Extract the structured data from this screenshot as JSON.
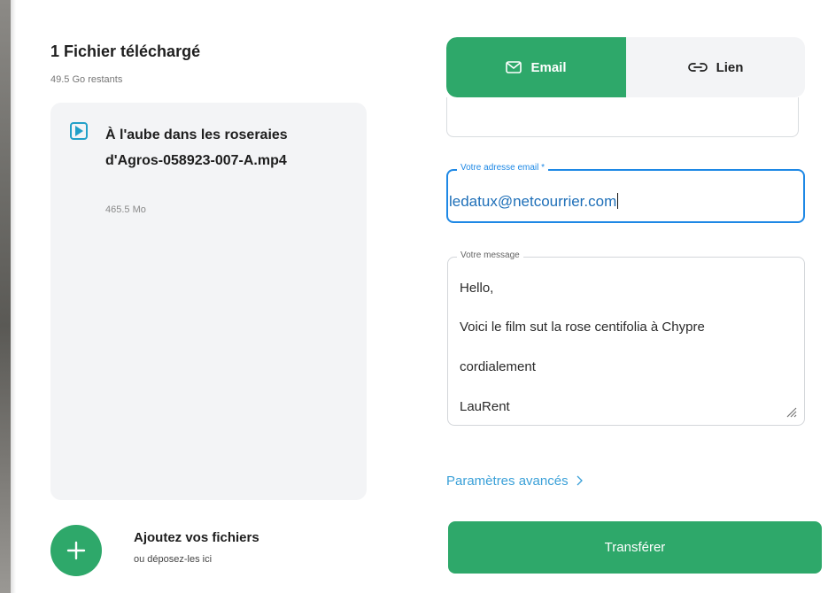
{
  "upload_panel": {
    "title": "1 Fichier téléchargé",
    "remaining": "49.5 Go restants",
    "file": {
      "name": "À l'aube dans les roseraies d'Agros-058923-007-A.mp4",
      "size": "465.5 Mo",
      "icon": "video-file-icon"
    },
    "add": {
      "title": "Ajoutez vos fichiers",
      "subtitle": "ou déposez-les ici",
      "icon": "plus-icon"
    }
  },
  "tabs": [
    {
      "label": "Email",
      "icon": "envelope-icon",
      "active": true
    },
    {
      "label": "Lien",
      "icon": "link-icon",
      "active": false
    }
  ],
  "form": {
    "email_label": "Votre adresse email *",
    "email_value": "ledatux@netcourrier.com",
    "message_label": "Votre message",
    "message_lines": [
      "Hello,",
      "Voici le film sut la rose centifolia à Chypre",
      "cordialement",
      "LauRent"
    ]
  },
  "advanced_link": "Paramètres avancés",
  "transfer_button": "Transférer",
  "colors": {
    "brand_green": "#2ea86a",
    "focus_blue": "#1e88e5",
    "link_blue": "#3aa0d8",
    "card_bg": "#f3f4f6"
  }
}
